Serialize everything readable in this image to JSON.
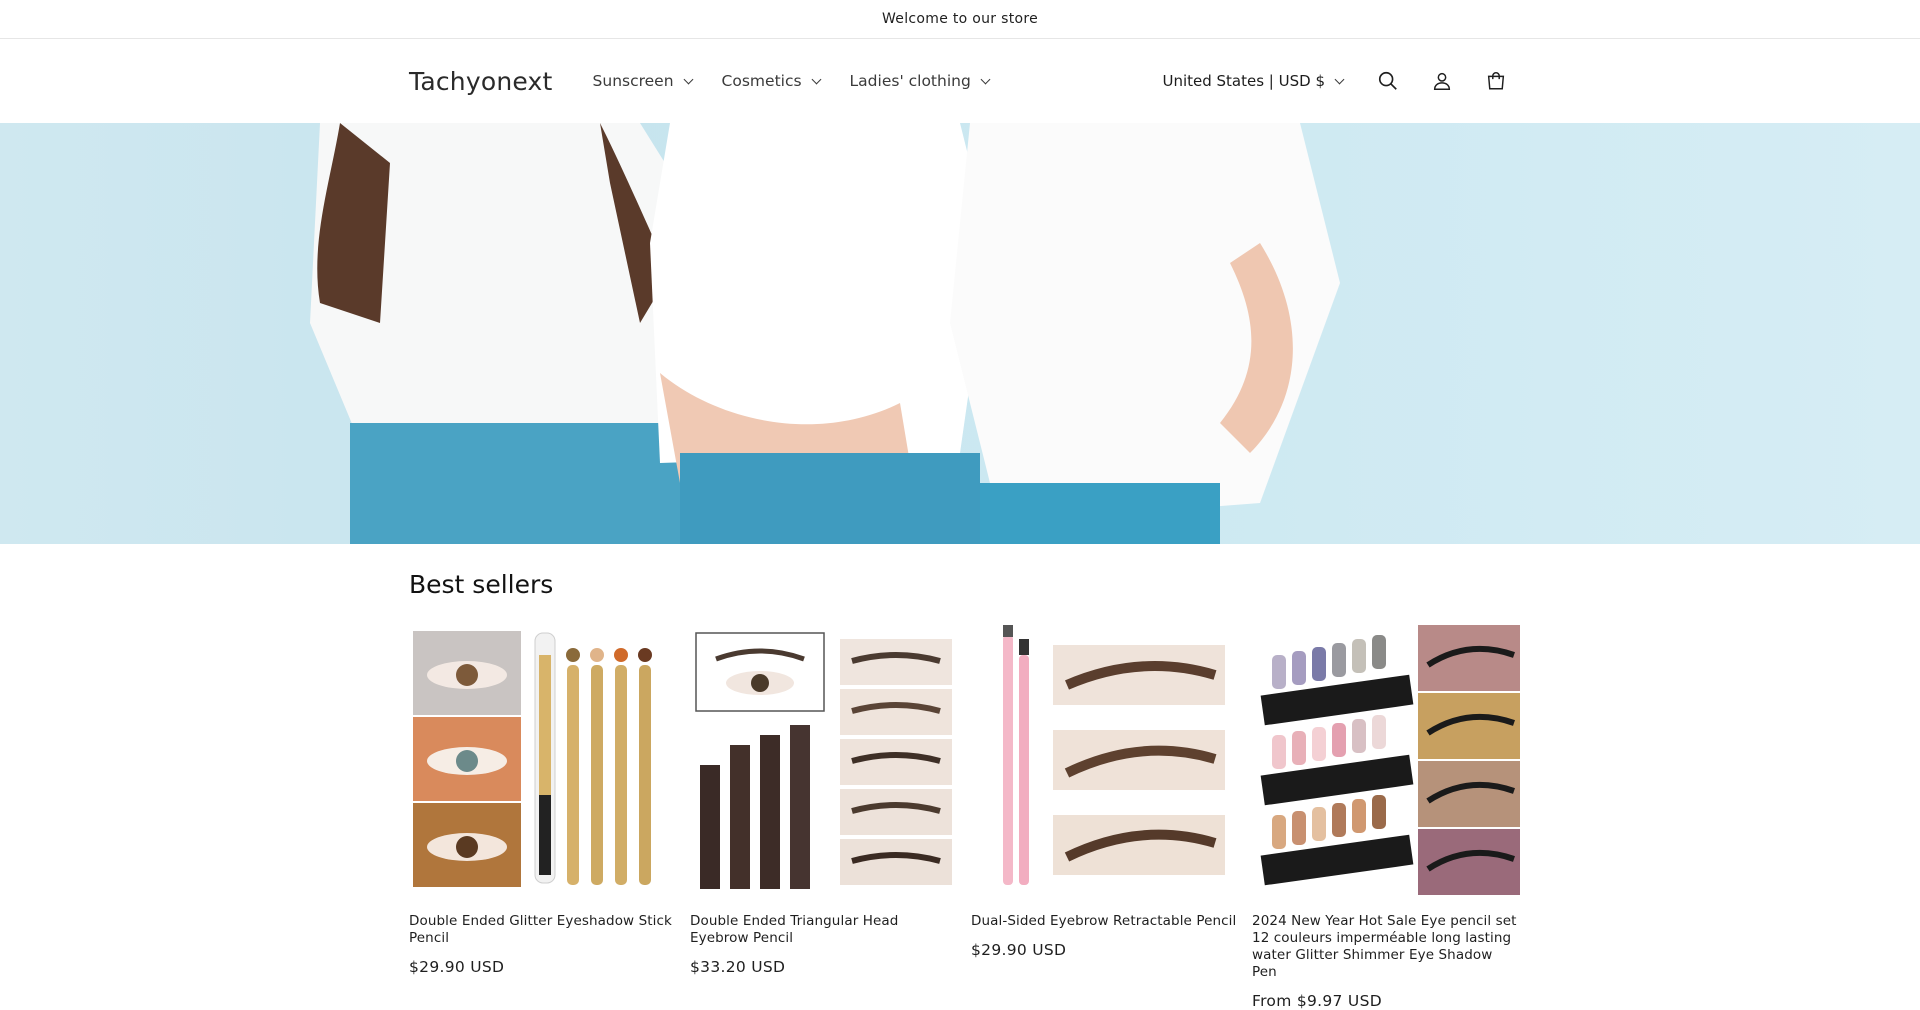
{
  "announcement": {
    "text": "Welcome to our store"
  },
  "header": {
    "logo": "Tachyonext",
    "nav": [
      {
        "label": "Sunscreen"
      },
      {
        "label": "Cosmetics"
      },
      {
        "label": "Ladies' clothing"
      }
    ],
    "locale": "United States | USD $",
    "icons": [
      "search-icon",
      "account-icon",
      "cart-icon"
    ]
  },
  "colors": {
    "hero_bg": "#cde9f2",
    "text": "#121212",
    "accent_pink": "#f4b8c8"
  },
  "section": {
    "title": "Best sellers",
    "products": [
      {
        "title": "Double Ended Glitter Eyeshadow Stick Pencil",
        "price": "$29.90 USD"
      },
      {
        "title": "Double Ended Triangular Head Eyebrow Pencil",
        "price": "$33.20 USD"
      },
      {
        "title": "Dual-Sided Eyebrow Retractable Pencil",
        "price": "$29.90 USD"
      },
      {
        "title": " 2024 New Year Hot Sale Eye pencil set 12 couleurs imperméable long lasting water Glitter Shimmer Eye Shadow Pen",
        "price": "From $9.97 USD"
      }
    ]
  }
}
